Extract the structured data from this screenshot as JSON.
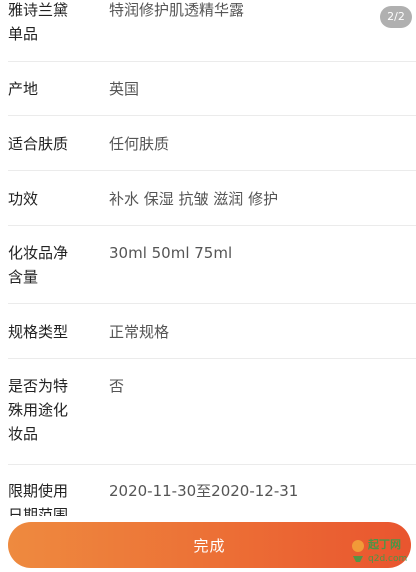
{
  "page_indicator": "2/2",
  "details": [
    {
      "label": "雅诗兰黛\n单品",
      "value": "特润修护肌透精华露"
    },
    {
      "label": "产地",
      "value": "英国"
    },
    {
      "label": "适合肤质",
      "value": "任何肤质"
    },
    {
      "label": "功效",
      "value": "补水 保湿 抗皱 滋润 修护"
    },
    {
      "label": "化妆品净\n含量",
      "value": "30ml 50ml 75ml"
    },
    {
      "label": "规格类型",
      "value": "正常规格"
    },
    {
      "label": "是否为特\n殊用途化\n妆品",
      "value": "否"
    },
    {
      "label": "限期使用\n日期范围",
      "value": "2020-11-30至2020-12-31"
    }
  ],
  "done_button": {
    "label": "完成"
  },
  "watermark": {
    "line1": "起丁网",
    "line2": "q2d.com"
  }
}
